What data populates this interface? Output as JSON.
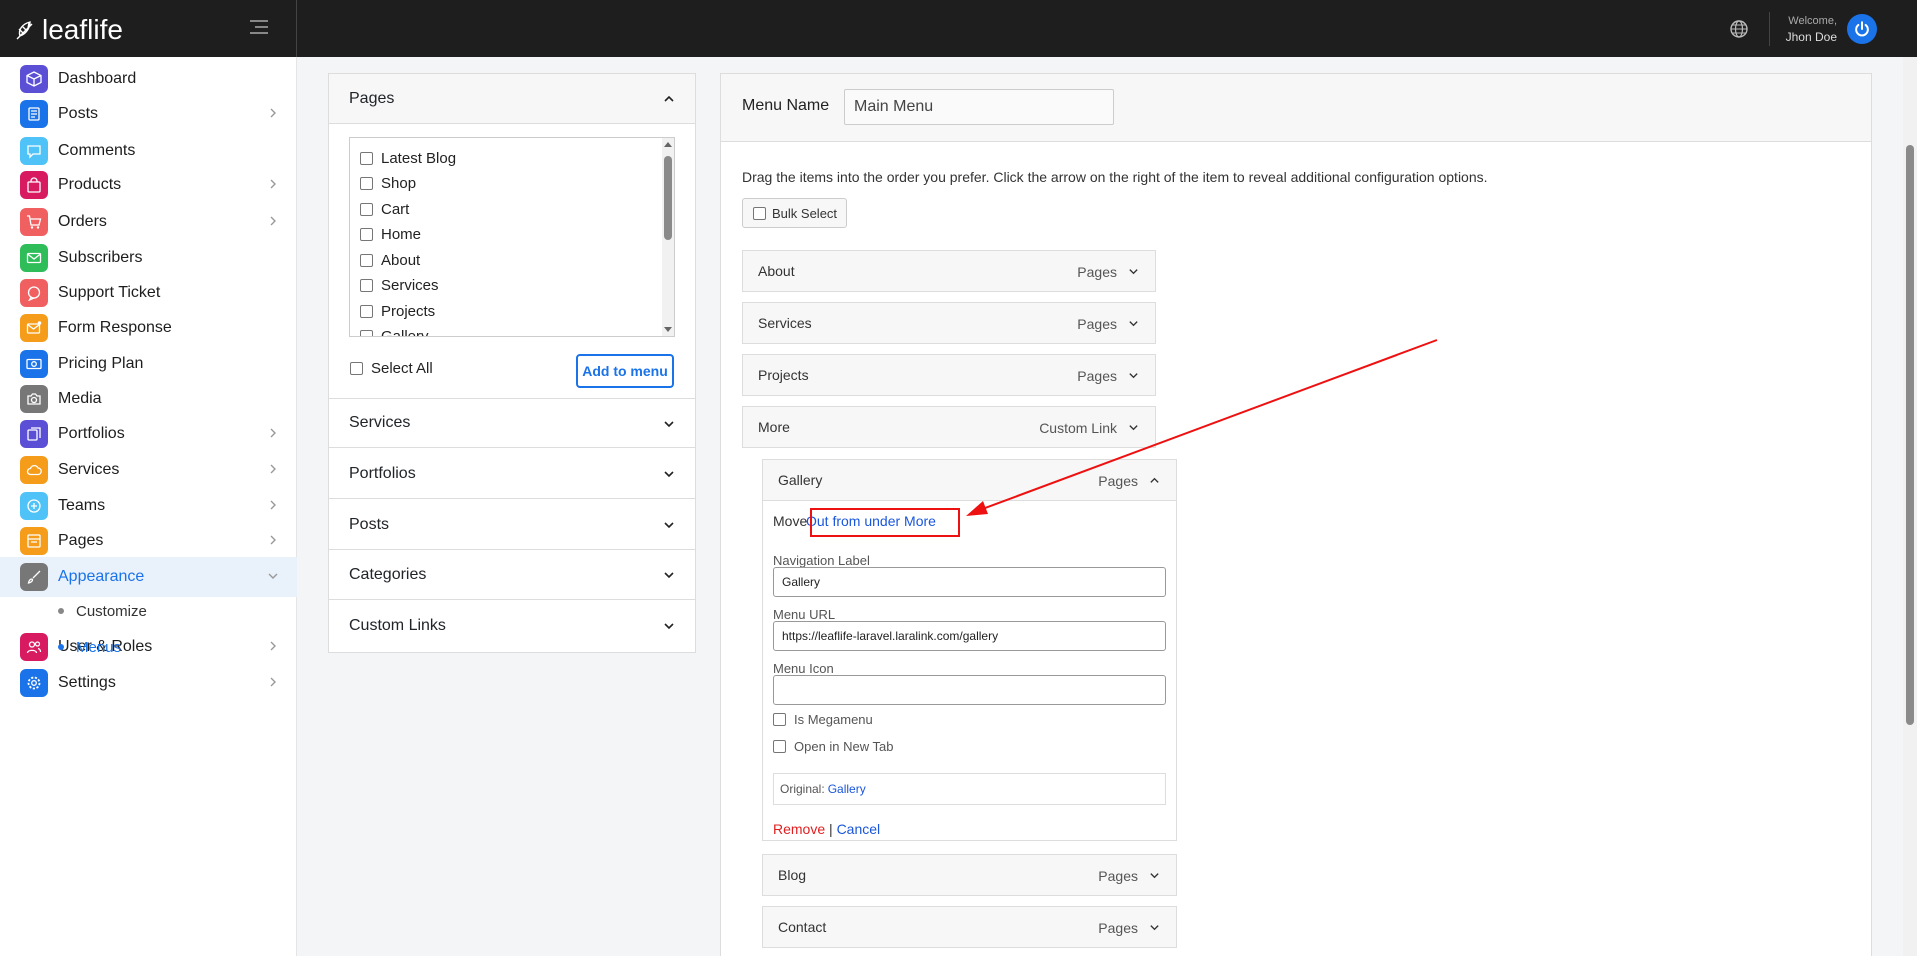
{
  "brand": {
    "name": "leaflife"
  },
  "header": {
    "welcome": "Welcome,",
    "user": "Jhon Doe"
  },
  "sidebar": {
    "items": [
      {
        "label": "Dashboard",
        "icon": "cube-icon",
        "color": "#5b4fd6",
        "has_children": false
      },
      {
        "label": "Posts",
        "icon": "document-icon",
        "color": "#1a73e8",
        "has_children": true
      },
      {
        "label": "Comments",
        "icon": "chat-icon",
        "color": "#4fc3f7",
        "has_children": false
      },
      {
        "label": "Products",
        "icon": "bag-icon",
        "color": "#d81b60",
        "has_children": true
      },
      {
        "label": "Orders",
        "icon": "cart-icon",
        "color": "#f06060",
        "has_children": true
      },
      {
        "label": "Subscribers",
        "icon": "mail-icon",
        "color": "#2ebd59",
        "has_children": false
      },
      {
        "label": "Support Ticket",
        "icon": "support-icon",
        "color": "#f06060",
        "has_children": false
      },
      {
        "label": "Form Response",
        "icon": "envelope-icon",
        "color": "#f59c1a",
        "has_children": false
      },
      {
        "label": "Pricing Plan",
        "icon": "money-icon",
        "color": "#1a73e8",
        "has_children": false
      },
      {
        "label": "Media",
        "icon": "camera-icon",
        "color": "#777777",
        "has_children": false
      },
      {
        "label": "Portfolios",
        "icon": "layers-icon",
        "color": "#5b4fd6",
        "has_children": true
      },
      {
        "label": "Services",
        "icon": "cloud-icon",
        "color": "#f59c1a",
        "has_children": true
      },
      {
        "label": "Teams",
        "icon": "plus-circle-icon",
        "color": "#4fc3f7",
        "has_children": true
      },
      {
        "label": "Pages",
        "icon": "page-icon",
        "color": "#f59c1a",
        "has_children": true
      },
      {
        "label": "Appearance",
        "icon": "brush-icon",
        "color": "#777777",
        "has_children": true
      },
      {
        "label": "User & Roles",
        "icon": "users-icon",
        "color": "#d81b60",
        "has_children": true
      },
      {
        "label": "Settings",
        "icon": "gear-icon",
        "color": "#1a73e8",
        "has_children": true
      }
    ],
    "sub_items": [
      {
        "label": "Customize"
      },
      {
        "label": "Menus"
      }
    ]
  },
  "accordion": {
    "sections": [
      "Pages",
      "Services",
      "Portfolios",
      "Posts",
      "Categories",
      "Custom Links"
    ],
    "pages_list": [
      "Latest Blog",
      "Shop",
      "Cart",
      "Home",
      "About",
      "Services",
      "Projects",
      "Gallery"
    ],
    "select_all": "Select All",
    "add_button": "Add to menu"
  },
  "menu": {
    "name_label": "Menu Name",
    "name_value": "Main Menu",
    "help_text": "Drag the items into the order you prefer. Click the arrow on the right of the item to reveal additional configuration options.",
    "bulk_select": "Bulk Select",
    "items": [
      {
        "label": "About",
        "type": "Pages"
      },
      {
        "label": "Services",
        "type": "Pages"
      },
      {
        "label": "Projects",
        "type": "Pages"
      },
      {
        "label": "More",
        "type": "Custom Link"
      },
      {
        "label": "Gallery",
        "type": "Pages"
      },
      {
        "label": "Blog",
        "type": "Pages"
      },
      {
        "label": "Contact",
        "type": "Pages"
      }
    ],
    "editor": {
      "move_label": "Move",
      "move_link": "Out from under More",
      "nav_label": "Navigation Label",
      "nav_value": "Gallery",
      "url_label": "Menu URL",
      "url_value": "https://leaflife-laravel.laralink.com/gallery",
      "icon_label": "Menu Icon",
      "icon_value": "",
      "megamenu": "Is Megamenu",
      "new_tab": "Open in New Tab",
      "original_label": "Original:",
      "original_link": "Gallery",
      "remove": "Remove",
      "separator": "|",
      "cancel": "Cancel"
    }
  },
  "colors": {
    "accent": "#1a73e8",
    "annotation": "#e11111",
    "topbar": "#1e1e1e"
  }
}
